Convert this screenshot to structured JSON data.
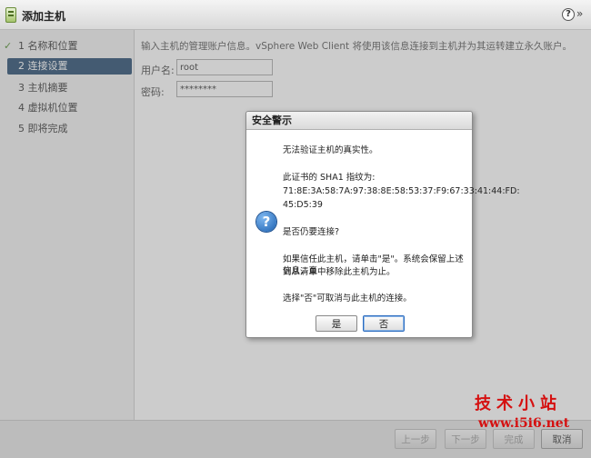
{
  "window": {
    "title": "添加主机"
  },
  "steps": [
    {
      "label": "1  名称和位置",
      "done": true
    },
    {
      "label": "2  连接设置",
      "active": true
    },
    {
      "label": "3  主机摘要"
    },
    {
      "label": "4  虚拟机位置"
    },
    {
      "label": "5  即将完成"
    }
  ],
  "form": {
    "intro": "输入主机的管理账户信息。vSphere Web Client 将使用该信息连接到主机并为其运转建立永久账户。",
    "username_label": "用户名:",
    "username_value": "root",
    "password_label": "密码:",
    "password_value": "********"
  },
  "footer": {
    "back": "上一步",
    "next": "下一步",
    "finish": "完成",
    "cancel": "取消"
  },
  "dialog": {
    "title": "安全警示",
    "line1": "无法验证主机的真实性。",
    "line2": "此证书的 SHA1 指纹为:",
    "fingerprint1": "71:8E:3A:58:7A:97:38:8E:58:53:37:F9:67:33:41:44:FD:",
    "fingerprint2": "45:D5:39",
    "question": "是否仍要连接?",
    "trust1": "如果信任此主机，请单击\"是\"。系统会保留上述信息，直",
    "trust2": "到从清单中移除此主机为止。",
    "cancel_note": "选择\"否\"可取消与此主机的连接。",
    "yes": "是",
    "no": "否"
  },
  "watermark": {
    "text": "技术小站",
    "url": "www.i5i6.net"
  }
}
